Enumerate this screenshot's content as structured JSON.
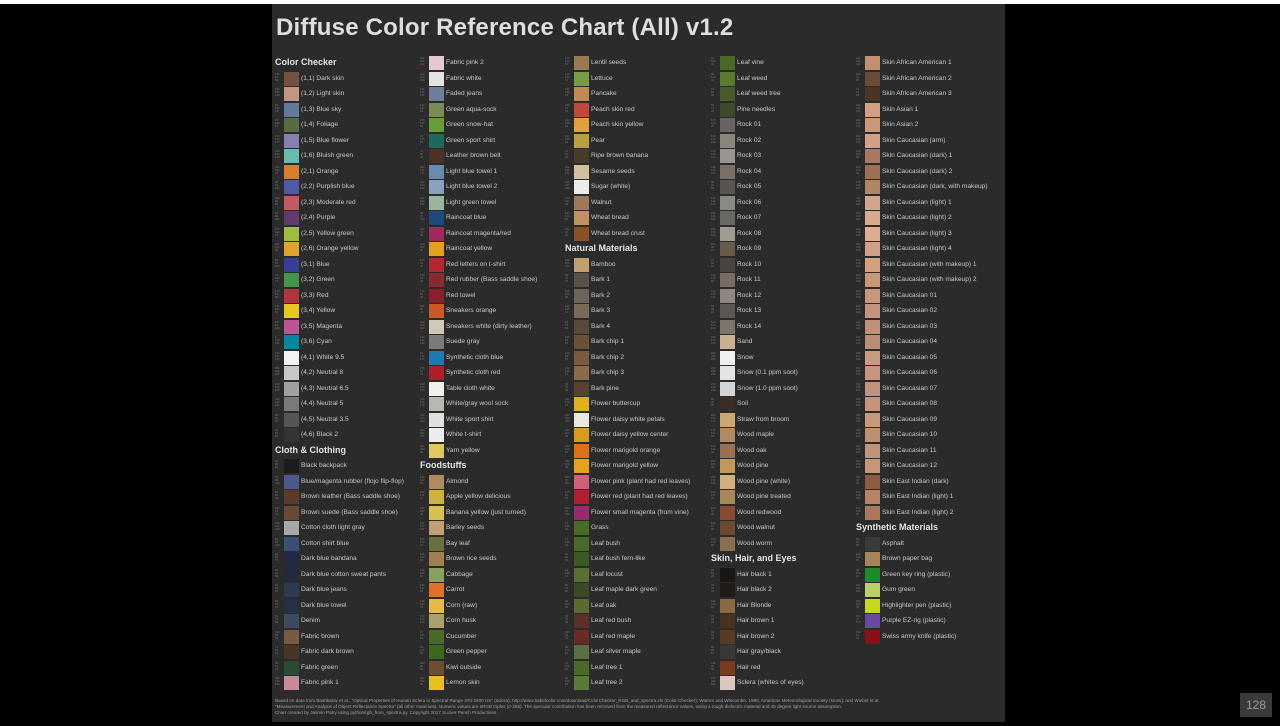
{
  "title": "Diffuse Color Reference Chart (All) v1.2",
  "page_counter": "128",
  "footer": [
    "Based on data from Bashkatov et al., \"Optical Properties of Human Sclera in Spectral Range 370-2500 nm\" (sclera); http://www.babelcolor.com/download/ColorChecker_RGB_and_spectra.xls (Color Checker); Warren and Wiscombe, 1980, American Meteorological Society (snow); and Wiebel et al.",
    "\"Measurement and Analysis of Object Reflectance Spectra\" (all other materials). Numeric values are sRGB triples (0-255). The specular contribution has been removed from the measured reflectance values, using a rough dielectric material and 45 degree light source assumption.",
    "Chart created by Jasmin Patry using python/rgb_from_spectra.py. Copyright 2017 Sucker Punch Productions."
  ],
  "columns": [
    [
      {
        "header": "Color Checker"
      },
      {
        "label": "(1,1) Dark skin",
        "color": "#735244"
      },
      {
        "label": "(1,2) Light skin",
        "color": "#c29682"
      },
      {
        "label": "(1,3) Blue sky",
        "color": "#627a9d"
      },
      {
        "label": "(1,4) Foliage",
        "color": "#576c43"
      },
      {
        "label": "(1,5) Blue flower",
        "color": "#8580b1"
      },
      {
        "label": "(1,6) Bluish green",
        "color": "#67bdaa"
      },
      {
        "label": "(2,1) Orange",
        "color": "#d67e2c"
      },
      {
        "label": "(2,2) Purplish blue",
        "color": "#505ba6"
      },
      {
        "label": "(2,3) Moderate red",
        "color": "#c15a63"
      },
      {
        "label": "(2,4) Purple",
        "color": "#5e3c6c"
      },
      {
        "label": "(2,5) Yellow green",
        "color": "#9dbc40"
      },
      {
        "label": "(2,6) Orange yellow",
        "color": "#e0a32e"
      },
      {
        "label": "(3,1) Blue",
        "color": "#383d96"
      },
      {
        "label": "(3,2) Green",
        "color": "#469449"
      },
      {
        "label": "(3,3) Red",
        "color": "#af363c"
      },
      {
        "label": "(3,4) Yellow",
        "color": "#e7c71f"
      },
      {
        "label": "(3,5) Magenta",
        "color": "#bb5695"
      },
      {
        "label": "(3,6) Cyan",
        "color": "#0885a1"
      },
      {
        "label": "(4,1) White 9.5",
        "color": "#f3f3f2"
      },
      {
        "label": "(4,2) Neutral 8",
        "color": "#c8c8c8"
      },
      {
        "label": "(4,3) Neutral 6.5",
        "color": "#a0a0a0"
      },
      {
        "label": "(4,4) Neutral 5",
        "color": "#7a7a79"
      },
      {
        "label": "(4,5) Neutral 3.5",
        "color": "#555555"
      },
      {
        "label": "(4,6) Black 2",
        "color": "#343434"
      },
      {
        "header": "Cloth & Clothing"
      },
      {
        "label": "Black backpack",
        "color": "#1c1c1c"
      },
      {
        "label": "Blue/magenta rubber (flojo flip-flop)",
        "color": "#4a5a8a"
      },
      {
        "label": "Brown leather (Bass saddle shoe)",
        "color": "#5e3a28"
      },
      {
        "label": "Brown suede (Bass saddle shoe)",
        "color": "#6b4a35"
      },
      {
        "label": "Cotton cloth light gray",
        "color": "#a8a8a8"
      },
      {
        "label": "Cotton shirt blue",
        "color": "#3a4e7a"
      },
      {
        "label": "Dark blue bandana",
        "color": "#222a48"
      },
      {
        "label": "Dark blue cotton sweat pants",
        "color": "#242a3e"
      },
      {
        "label": "Dark blue jeans",
        "color": "#2e3a52"
      },
      {
        "label": "Dark blue towel",
        "color": "#283048"
      },
      {
        "label": "Denim",
        "color": "#3e4a62"
      },
      {
        "label": "Fabric brown",
        "color": "#7a5a40"
      },
      {
        "label": "Fabric dark brown",
        "color": "#4a3428"
      },
      {
        "label": "Fabric green",
        "color": "#2e4a32"
      },
      {
        "label": "Fabric pink 1",
        "color": "#c88a9a"
      }
    ],
    [
      {
        "label": "Fabric pink 2",
        "color": "#e8c8d0"
      },
      {
        "label": "Fabric white",
        "color": "#e4e4e0"
      },
      {
        "label": "Faded jeans",
        "color": "#6e7e98"
      },
      {
        "label": "Green aqua-sock",
        "color": "#7a8a58"
      },
      {
        "label": "Green snow-hat",
        "color": "#6a9a3a"
      },
      {
        "label": "Green sport shirt",
        "color": "#1e6a5a"
      },
      {
        "label": "Leather brown belt",
        "color": "#4a3228"
      },
      {
        "label": "Light blue towel 1",
        "color": "#6a8ab0"
      },
      {
        "label": "Light blue towel 2",
        "color": "#8aa0c0"
      },
      {
        "label": "Light green towel",
        "color": "#9ab4a0"
      },
      {
        "label": "Raincoat blue",
        "color": "#1e4a80"
      },
      {
        "label": "Raincoat magenta/red",
        "color": "#a02a5a"
      },
      {
        "label": "Raincoat yellow",
        "color": "#e0a020"
      },
      {
        "label": "Red letters on t-shirt",
        "color": "#b02a30"
      },
      {
        "label": "Red rubber (Bass saddle shoe)",
        "color": "#8a2a30"
      },
      {
        "label": "Red towel",
        "color": "#8a1e2a"
      },
      {
        "label": "Sneakers orange",
        "color": "#c85a2a"
      },
      {
        "label": "Sneakers white (dirty leather)",
        "color": "#d0c8b8"
      },
      {
        "label": "Suede gray",
        "color": "#7a7a78"
      },
      {
        "label": "Synthetic cloth blue",
        "color": "#1e7ab0"
      },
      {
        "label": "Synthetic cloth red",
        "color": "#b01e2a"
      },
      {
        "label": "Table cloth white",
        "color": "#f0f0ec"
      },
      {
        "label": "White/gray wool sock",
        "color": "#b8b8b0"
      },
      {
        "label": "White sport shirt",
        "color": "#e0e0e0"
      },
      {
        "label": "White t-shirt",
        "color": "#ececec"
      },
      {
        "label": "Yarn yellow",
        "color": "#e0c860"
      },
      {
        "header": "Foodstuffs"
      },
      {
        "label": "Almond",
        "color": "#b08a60"
      },
      {
        "label": "Apple yellow delicious",
        "color": "#d0b040"
      },
      {
        "label": "Banana yellow (just turned)",
        "color": "#d8c050"
      },
      {
        "label": "Barley seeds",
        "color": "#c0a070"
      },
      {
        "label": "Bay leaf",
        "color": "#6a7040"
      },
      {
        "label": "Brown rice seeds",
        "color": "#a08050"
      },
      {
        "label": "Cabbage",
        "color": "#8aa060"
      },
      {
        "label": "Carrot",
        "color": "#e0702a"
      },
      {
        "label": "Corn (raw)",
        "color": "#e8b848"
      },
      {
        "label": "Corn husk",
        "color": "#a8a070"
      },
      {
        "label": "Cucumber",
        "color": "#4a6a2a"
      },
      {
        "label": "Green pepper",
        "color": "#3a6a1e"
      },
      {
        "label": "Kiwi outside",
        "color": "#6a5030"
      },
      {
        "label": "Lemon skin",
        "color": "#e8c020"
      }
    ],
    [
      {
        "label": "Lentil seeds",
        "color": "#9a7a50"
      },
      {
        "label": "Lettuce",
        "color": "#7a9a48"
      },
      {
        "label": "Pancake",
        "color": "#c08a50"
      },
      {
        "label": "Peach skin red",
        "color": "#c04a3a"
      },
      {
        "label": "Peach skin yellow",
        "color": "#e0a040"
      },
      {
        "label": "Pear",
        "color": "#b8a040"
      },
      {
        "label": "Ripe brown banana",
        "color": "#4a3a28"
      },
      {
        "label": "Sesame seeds",
        "color": "#d0c0a0"
      },
      {
        "label": "Sugar (white)",
        "color": "#ececec"
      },
      {
        "label": "Walnut",
        "color": "#9a7a58"
      },
      {
        "label": "Wheat bread",
        "color": "#c09060"
      },
      {
        "label": "Wheat bread crust",
        "color": "#8a5028"
      },
      {
        "header": "Natural Materials"
      },
      {
        "label": "Bamboo",
        "color": "#c0a070"
      },
      {
        "label": "Bark 1",
        "color": "#5a5248"
      },
      {
        "label": "Bark 2",
        "color": "#6a645a"
      },
      {
        "label": "Bark 3",
        "color": "#7a6a58"
      },
      {
        "label": "Bark 4",
        "color": "#5a4a3a"
      },
      {
        "label": "Bark chip 1",
        "color": "#6a5038"
      },
      {
        "label": "Bark chip 2",
        "color": "#7a5a40"
      },
      {
        "label": "Bark chip 3",
        "color": "#8a6a48"
      },
      {
        "label": "Bark pine",
        "color": "#5a4030"
      },
      {
        "label": "Flower buttercup",
        "color": "#e0b020"
      },
      {
        "label": "Flower daisy white petals",
        "color": "#e8e8e0"
      },
      {
        "label": "Flower daisy yellow center",
        "color": "#d89a20"
      },
      {
        "label": "Flower marigold orange",
        "color": "#e07018"
      },
      {
        "label": "Flower marigold yellow",
        "color": "#e8a020"
      },
      {
        "label": "Flower pink (plant had red leaves)",
        "color": "#d0607a"
      },
      {
        "label": "Flower red (plant had red leaves)",
        "color": "#b02030"
      },
      {
        "label": "Flower small magenta (from vine)",
        "color": "#9a2a6a"
      },
      {
        "label": "Grass",
        "color": "#4a6a28"
      },
      {
        "label": "Leaf bush",
        "color": "#4a6a2a"
      },
      {
        "label": "Leaf bush fern-like",
        "color": "#3a5a20"
      },
      {
        "label": "Leaf locust",
        "color": "#5a7030"
      },
      {
        "label": "Leaf maple dark green",
        "color": "#3a4a28"
      },
      {
        "label": "Leaf oak",
        "color": "#5a6a30"
      },
      {
        "label": "Leaf red bush",
        "color": "#5a3028"
      },
      {
        "label": "Leaf red maple",
        "color": "#6a2a28"
      },
      {
        "label": "Leaf silver maple",
        "color": "#5a7040"
      },
      {
        "label": "Leaf tree 1",
        "color": "#4a6a2a"
      },
      {
        "label": "Leaf tree 2",
        "color": "#5a7a38"
      }
    ],
    [
      {
        "label": "Leaf vine",
        "color": "#4a6a28"
      },
      {
        "label": "Leaf weed",
        "color": "#5a7a30"
      },
      {
        "label": "Leaf weed tree",
        "color": "#4a5a28"
      },
      {
        "label": "Pine needles",
        "color": "#3a4a2a"
      },
      {
        "label": "Rock 01",
        "color": "#6a6460"
      },
      {
        "label": "Rock 02",
        "color": "#8a847a"
      },
      {
        "label": "Rock 03",
        "color": "#9a9490"
      },
      {
        "label": "Rock 04",
        "color": "#7a7068"
      },
      {
        "label": "Rock 05",
        "color": "#5a5450"
      },
      {
        "label": "Rock 06",
        "color": "#8a8a84"
      },
      {
        "label": "Rock 07",
        "color": "#6a6a64"
      },
      {
        "label": "Rock 08",
        "color": "#a09a90"
      },
      {
        "label": "Rock 09",
        "color": "#6a5a4a"
      },
      {
        "label": "Rock 10",
        "color": "#4a4440"
      },
      {
        "label": "Rock 11",
        "color": "#7a6e62"
      },
      {
        "label": "Rock 12",
        "color": "#90887e"
      },
      {
        "label": "Rock 13",
        "color": "#5e5852"
      },
      {
        "label": "Rock 14",
        "color": "#7e766c"
      },
      {
        "label": "Sand",
        "color": "#c8b090"
      },
      {
        "label": "Snow",
        "color": "#f0f0f0"
      },
      {
        "label": "Snow (0.1 ppm soot)",
        "color": "#e4e4e4"
      },
      {
        "label": "Snow (1.0 ppm soot)",
        "color": "#d4d4d4"
      },
      {
        "label": "Soil",
        "color": "#3a2e24"
      },
      {
        "label": "Straw from broom",
        "color": "#c8a870"
      },
      {
        "label": "Wood maple",
        "color": "#b08a60"
      },
      {
        "label": "Wood oak",
        "color": "#9a7050"
      },
      {
        "label": "Wood pine",
        "color": "#c0985a"
      },
      {
        "label": "Wood pine (white)",
        "color": "#d0b080"
      },
      {
        "label": "Wood pine treated",
        "color": "#a88858"
      },
      {
        "label": "Wood redwood",
        "color": "#8a4a30"
      },
      {
        "label": "Wood walnut",
        "color": "#6a4a30"
      },
      {
        "label": "Wood worm",
        "color": "#8a7050"
      },
      {
        "header": "Skin, Hair, and Eyes"
      },
      {
        "label": "Hair black 1",
        "color": "#1a1614"
      },
      {
        "label": "Hair black 2",
        "color": "#221c18"
      },
      {
        "label": "Hair Blonde",
        "color": "#8a6a40"
      },
      {
        "label": "Hair brown 1",
        "color": "#4a3020"
      },
      {
        "label": "Hair brown 2",
        "color": "#5a3a22"
      },
      {
        "label": "Hair gray/black",
        "color": "#3a3836"
      },
      {
        "label": "Hair red",
        "color": "#7a3a1e"
      },
      {
        "label": "Sclera (whites of eyes)",
        "color": "#d8c8c0"
      }
    ],
    [
      {
        "label": "Skin African American 1",
        "color": "#c09070"
      },
      {
        "label": "Skin African American 2",
        "color": "#6a4a38"
      },
      {
        "label": "Skin African American 3",
        "color": "#4a3428"
      },
      {
        "label": "Skin Asian 1",
        "color": "#d0a080"
      },
      {
        "label": "Skin Asian 2",
        "color": "#c8987a"
      },
      {
        "label": "Skin Caucasian (arm)",
        "color": "#d0a088"
      },
      {
        "label": "Skin Caucasian (dark) 1",
        "color": "#a87860"
      },
      {
        "label": "Skin Caucasian (dark) 2",
        "color": "#9a7058"
      },
      {
        "label": "Skin Caucasian (dark, with makeup)",
        "color": "#b08468"
      },
      {
        "label": "Skin Caucasian (light) 1",
        "color": "#d4a48c"
      },
      {
        "label": "Skin Caucasian (light) 2",
        "color": "#d8a890"
      },
      {
        "label": "Skin Caucasian (light) 3",
        "color": "#dcac94"
      },
      {
        "label": "Skin Caucasian (light) 4",
        "color": "#d0a088"
      },
      {
        "label": "Skin Caucasian (with makeup) 1",
        "color": "#d4a080"
      },
      {
        "label": "Skin Caucasian (with makeup) 2",
        "color": "#c89878"
      },
      {
        "label": "Skin Caucasian 01",
        "color": "#c8987e"
      },
      {
        "label": "Skin Caucasian 02",
        "color": "#c49480"
      },
      {
        "label": "Skin Caucasian 03",
        "color": "#c0907a"
      },
      {
        "label": "Skin Caucasian 04",
        "color": "#bc8c76"
      },
      {
        "label": "Skin Caucasian 05",
        "color": "#c89a84"
      },
      {
        "label": "Skin Caucasian 06",
        "color": "#c49682"
      },
      {
        "label": "Skin Caucasian 07",
        "color": "#c0927c"
      },
      {
        "label": "Skin Caucasian 08",
        "color": "#c49478"
      },
      {
        "label": "Skin Caucasian 09",
        "color": "#c8987c"
      },
      {
        "label": "Skin Caucasian 10",
        "color": "#bc8e72"
      },
      {
        "label": "Skin Caucasian 11",
        "color": "#c09278"
      },
      {
        "label": "Skin Caucasian 12",
        "color": "#c4967e"
      },
      {
        "label": "Skin East Indian (dark)",
        "color": "#8a5e44"
      },
      {
        "label": "Skin East Indian (light) 1",
        "color": "#b88466"
      },
      {
        "label": "Skin East Indian (light) 2",
        "color": "#a87858"
      },
      {
        "header": "Synthetic Materials"
      },
      {
        "label": "Asphalt",
        "color": "#3a3a38"
      },
      {
        "label": "Brown paper bag",
        "color": "#a8845a"
      },
      {
        "label": "Green key ring (plastic)",
        "color": "#1e8a2a"
      },
      {
        "label": "Gum green",
        "color": "#b8d06a"
      },
      {
        "label": "Highlighter pen (plastic)",
        "color": "#c8d820"
      },
      {
        "label": "Purple EZ-rig (plastic)",
        "color": "#6a4aa0"
      },
      {
        "label": "Swiss army knife (plastic)",
        "color": "#8a1018"
      }
    ]
  ]
}
